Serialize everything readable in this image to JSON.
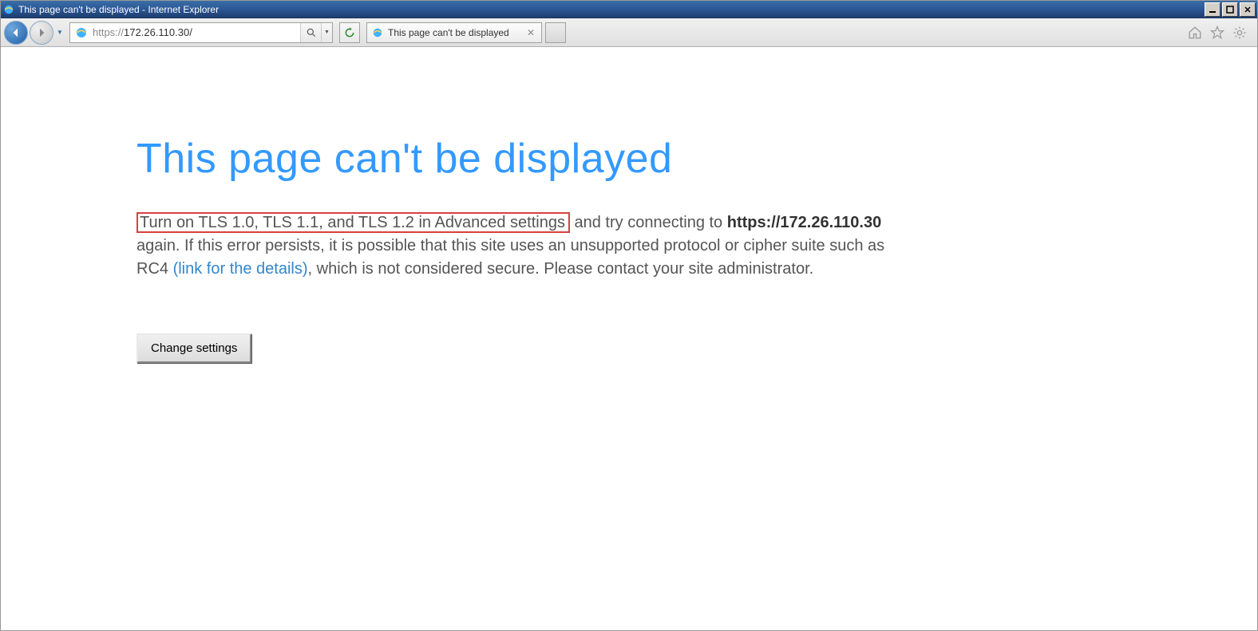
{
  "window": {
    "title": "This page can't be displayed - Internet Explorer"
  },
  "toolbar": {
    "url_prefix": "https://",
    "url_host": "172.26.110.30/",
    "tab_label": "This page can't be displayed"
  },
  "error": {
    "heading": "This page can't be displayed",
    "highlighted": "Turn on TLS 1.0, TLS 1.1, and TLS 1.2 in Advanced settings",
    "body_after_highlight": " and try connecting to ",
    "url_bold": "https://172.26.110.30",
    "body_after_url_1": " again. If this error persists, it is possible that this site uses an unsupported protocol or cipher suite such as RC4 ",
    "details_link": "(link for the details)",
    "body_after_link": ", which is not considered secure. Please contact your site administrator.",
    "button_label": "Change settings"
  }
}
